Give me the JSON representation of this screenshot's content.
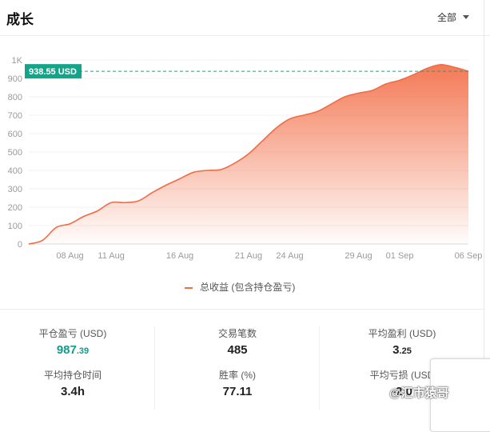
{
  "header": {
    "title": "成长",
    "filter_label": "全部"
  },
  "chart_data": {
    "type": "area",
    "title": "",
    "xlabel": "",
    "ylabel": "",
    "ylim": [
      0,
      1000
    ],
    "y_ticks": [
      "0",
      "100",
      "200",
      "300",
      "400",
      "500",
      "600",
      "700",
      "800",
      "900",
      "1K"
    ],
    "x_ticks": [
      "08 Aug",
      "11 Aug",
      "16 Aug",
      "21 Aug",
      "24 Aug",
      "29 Aug",
      "01 Sep",
      "06 Sep"
    ],
    "current_value_label": "938.55 USD",
    "current_value": 938.55,
    "series": [
      {
        "name": "总收益 (包含持仓盈亏)",
        "color": "#f26b43",
        "points": [
          [
            "05 Aug",
            0
          ],
          [
            "06 Aug",
            20
          ],
          [
            "07 Aug",
            90
          ],
          [
            "08 Aug",
            110
          ],
          [
            "09 Aug",
            150
          ],
          [
            "10 Aug",
            180
          ],
          [
            "11 Aug",
            225
          ],
          [
            "12 Aug",
            225
          ],
          [
            "13 Aug",
            235
          ],
          [
            "14 Aug",
            280
          ],
          [
            "15 Aug",
            320
          ],
          [
            "16 Aug",
            355
          ],
          [
            "17 Aug",
            390
          ],
          [
            "18 Aug",
            400
          ],
          [
            "19 Aug",
            405
          ],
          [
            "20 Aug",
            440
          ],
          [
            "21 Aug",
            490
          ],
          [
            "22 Aug",
            560
          ],
          [
            "23 Aug",
            630
          ],
          [
            "24 Aug",
            680
          ],
          [
            "25 Aug",
            700
          ],
          [
            "26 Aug",
            720
          ],
          [
            "27 Aug",
            760
          ],
          [
            "28 Aug",
            800
          ],
          [
            "29 Aug",
            820
          ],
          [
            "30 Aug",
            835
          ],
          [
            "31 Aug",
            870
          ],
          [
            "01 Sep",
            890
          ],
          [
            "02 Sep",
            920
          ],
          [
            "03 Sep",
            955
          ],
          [
            "04 Sep",
            975
          ],
          [
            "05 Sep",
            960
          ],
          [
            "06 Sep",
            938.55
          ]
        ]
      }
    ],
    "legend": "bottom-center",
    "grid": true
  },
  "stats": {
    "closed_pnl": {
      "label": "平仓盈亏 (USD)",
      "int": "987",
      "dec": ".39",
      "color": "#0f9d8a"
    },
    "trades": {
      "label": "交易笔数",
      "value": "485"
    },
    "avg_profit": {
      "label": "平均盈利 (USD)",
      "int": "3",
      "dec": ".25"
    },
    "avg_hold": {
      "label": "平均持仓时间",
      "value": "3.4h"
    },
    "win_rate": {
      "label": "胜率 (%)",
      "value": "77.11"
    },
    "avg_loss": {
      "label": "平均亏损 (USD",
      "value": "-2.0"
    }
  },
  "watermark": {
    "text": "@汇市猿哥"
  }
}
